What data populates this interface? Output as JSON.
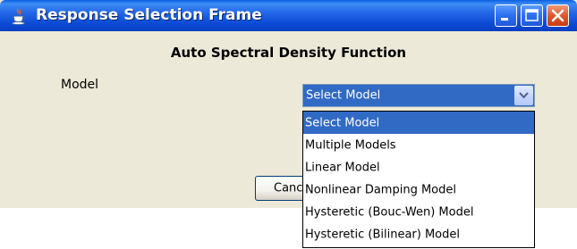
{
  "window": {
    "title": "Response Selection Frame",
    "icon": "java-cup-icon",
    "controls": [
      "minimize-icon",
      "maximize-icon",
      "close-icon"
    ]
  },
  "content": {
    "heading": "Auto Spectral Density Function",
    "model_label": "Model",
    "model_select": {
      "selected": "Select Model",
      "options": [
        "Select Model",
        "Multiple Models",
        "Linear Model",
        "Nonlinear Damping Model",
        "Hysteretic (Bouc-Wen) Model",
        "Hysteretic (Bilinear) Model"
      ]
    },
    "cancel_label": "Cancel"
  },
  "colors": {
    "titlebar": "#0a4bd6",
    "window_bg": "#ece9d8",
    "selection": "#316ac5",
    "close_button": "#e0572c"
  }
}
